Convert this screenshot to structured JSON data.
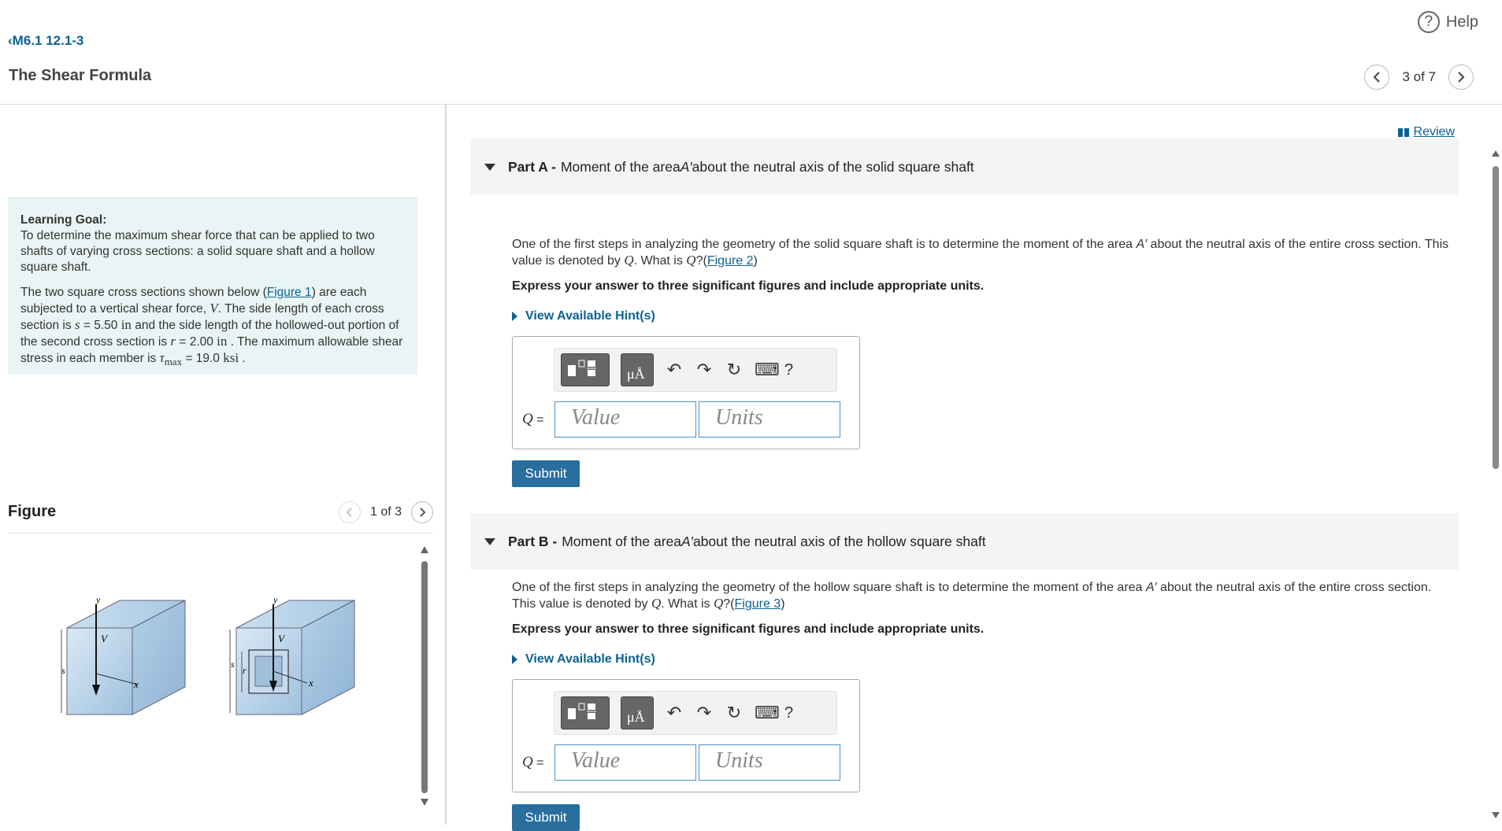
{
  "header": {
    "back_link": "M6.1 12.1-3",
    "title": "The Shear Formula",
    "help": "Help",
    "pager": "3 of 7"
  },
  "left": {
    "goal_title": "Learning Goal:",
    "goal_text": "To determine the maximum shear force that can be applied to two shafts of varying cross sections: a solid square shaft and a hollow square shaft.",
    "p2_a": "The two square cross sections shown below (",
    "p2_link": "Figure 1",
    "p2_b": ") are each subjected to a vertical shear force, ",
    "p2_V": "V",
    "p2_c": ". The side length of each cross section is ",
    "p2_s": "s",
    "p2_d": " = 5.50 ",
    "p2_in1": "in",
    "p2_e": " and the side length of the hollowed-out portion of the second cross section is ",
    "p2_r": "r",
    "p2_f": " = 2.00 ",
    "p2_in2": "in",
    "p2_g": " . The maximum allowable shear stress in each member is ",
    "p2_tau": "τ",
    "p2_max": "max",
    "p2_h": " = 19.0 ",
    "p2_ksi": "ksi",
    "p2_i": " .",
    "figure_title": "Figure",
    "figure_pager": "1 of 3",
    "fig_labels": {
      "y": "y",
      "V": "V",
      "x": "x",
      "s": "s",
      "r": "r"
    }
  },
  "right": {
    "review": "Review",
    "parts": [
      {
        "label": "Part A -",
        "title_a": "Moment of the area ",
        "title_A": "A′",
        "title_b": " about the neutral axis of the solid square shaft",
        "desc_a": "One of the first steps in analyzing the geometry of the solid square shaft is to determine the moment of the area ",
        "desc_A": "A′",
        "desc_b": " about the neutral axis of the entire cross section. This value is denoted by ",
        "desc_Q": "Q",
        "desc_c": ". What is ",
        "desc_Q2": "Q",
        "desc_d": "?(",
        "fig_link": "Figure 2",
        "desc_e": ")",
        "instruction": "Express your answer to three significant figures and include appropriate units.",
        "hint": "View Available Hint(s)",
        "q_label": "Q",
        "value_placeholder": "Value",
        "units_placeholder": "Units",
        "submit": "Submit"
      },
      {
        "label": "Part B -",
        "title_a": "Moment of the area ",
        "title_A": "A′",
        "title_b": " about the neutral axis of the hollow square shaft",
        "desc_a": "One of the first steps in analyzing the geometry of the hollow square shaft is to determine the moment of the area ",
        "desc_A": "A′",
        "desc_b": " about the neutral axis of the entire cross section. This value is denoted by ",
        "desc_Q": "Q",
        "desc_c": ". What is ",
        "desc_Q2": "Q",
        "desc_d": "?(",
        "fig_link": "Figure 3",
        "desc_e": ")",
        "instruction": "Express your answer to three significant figures and include appropriate units.",
        "hint": "View Available Hint(s)",
        "q_label": "Q",
        "value_placeholder": "Value",
        "units_placeholder": "Units",
        "submit": "Submit"
      }
    ],
    "toolbar": {
      "mu_label": "μÅ",
      "help": "?"
    }
  },
  "colors": {
    "link": "#0c6193",
    "goal_bg": "#e9f5f4",
    "submit_bg": "#2a6e9e",
    "part_head_bg": "#f4f4f4"
  }
}
